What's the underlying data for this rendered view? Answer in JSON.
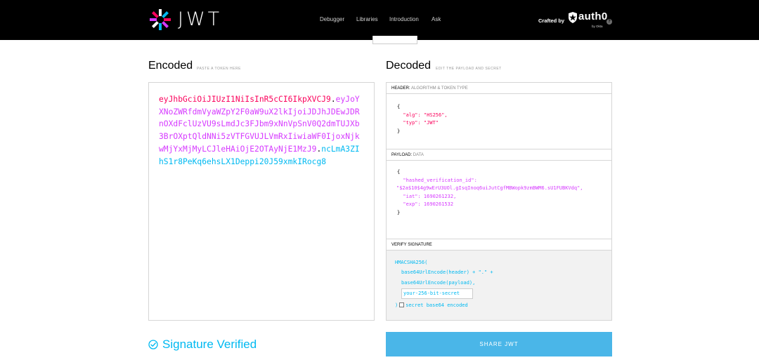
{
  "nav": {
    "brand": "JWT",
    "links": [
      "Debugger",
      "Libraries",
      "Introduction",
      "Ask"
    ],
    "crafted_by": "Crafted by",
    "partner": "auth0",
    "partner_sub": "by Okta",
    "info_glyph": "?"
  },
  "encoded": {
    "title": "Encoded",
    "subtitle": "PASTE A TOKEN HERE",
    "token_header": "eyJhbGciOiJIUzI1NiIsInR5cCI6IkpXVCJ9",
    "token_payload": "eyJoYXNoZWRfdmVyaWZpY2F0aW9uX2lkIjoiJDJhJDEwJDRnOXdFclUzVU9sLmdJc3FJbm9xNnVpSnV0Q2dmTUJXb3BrOXptQldNNi5zVTFGVUJLVmRxIiwiaWF0IjoxNjkwMjYxMjMyLCJleHAiOjE2OTAyNjE1MzJ9",
    "token_signature": "ncLmA3ZIhS1r8PeKq6ehsLX1Deppi20J59xmkIRocg8",
    "dot": "."
  },
  "decoded": {
    "title": "Decoded",
    "subtitle": "EDIT THE PAYLOAD AND SECRET",
    "header_section": {
      "label": "HEADER:",
      "note": "ALGORITHM & TOKEN TYPE",
      "lines": [
        "{",
        "  \"alg\": \"HS256\",",
        "  \"typ\": \"JWT\"",
        "}"
      ]
    },
    "payload_section": {
      "label": "PAYLOAD:",
      "note": "DATA",
      "lines": [
        "{",
        "  \"hashed_verification_id\":",
        "\"$2a$10$4g9wErU3UOl.gIsqInoq6uiJutCgfMBWopk9zmBWM6.sU1FUBKVdq\",",
        "  \"iat\": 1690261232,",
        "  \"exp\": 1690261532",
        "}"
      ]
    },
    "signature_section": {
      "label": "VERIFY SIGNATURE",
      "fn": "HMACSHA256(",
      "line1": "base64UrlEncode(header) + \".\" +",
      "line2": "base64UrlEncode(payload),",
      "secret_value": "your-256-bit-secret",
      "close": ")",
      "checkbox_label": "secret base64 encoded"
    }
  },
  "status": {
    "verified_text": "Signature Verified"
  },
  "share_button": "SHARE JWT",
  "colors": {
    "header": "#fb015b",
    "payload": "#d63aff",
    "signature": "#00b9f1",
    "share": "#4ab6e8"
  }
}
